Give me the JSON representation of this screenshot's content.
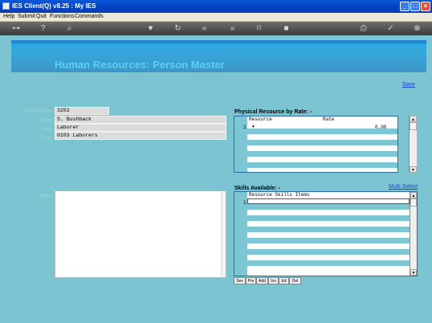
{
  "window": {
    "title": "IES Client(Q) v8.25 : My IES"
  },
  "menu": {
    "items": [
      "Help",
      "Submit",
      "Quit",
      "Functions",
      "Commands"
    ]
  },
  "page": {
    "heading": "Human Resources: Person Master",
    "save_label": "Save"
  },
  "form": {
    "individual_key_label": "Individual Key",
    "individual_key_value": "3202",
    "name_label": "Name",
    "name_value": "S. Bushback",
    "class_label": "Class",
    "class_value": "Laborer",
    "team_label": "Team",
    "team_value": "0103 Laborers",
    "notes_label": "Notes"
  },
  "rate_grid": {
    "title": "Physical Resource by Rate: -",
    "columns": [
      "Resource",
      "Rate"
    ],
    "rows": [
      {
        "num": "1",
        "resource": "▼",
        "rate": "0.00"
      }
    ]
  },
  "skills_grid": {
    "title": "Skills Available: -",
    "multi_select_label": "Multi Select",
    "columns": [
      "Resource Skills Items"
    ],
    "rows": [
      {
        "num": "1",
        "value": ""
      }
    ],
    "buttons": [
      "Sev",
      "Pre",
      "Add",
      "Ins",
      "Ed",
      "Del"
    ]
  },
  "icons": [
    "app-icon",
    "minimize-icon",
    "maximize-icon",
    "close-icon",
    "key-icon",
    "help-icon",
    "search-icon",
    "heart-icon",
    "refresh-icon",
    "back-icon",
    "forward-icon",
    "bookmark-icon",
    "stop-icon",
    "print-icon",
    "check-icon",
    "exit-icon"
  ]
}
